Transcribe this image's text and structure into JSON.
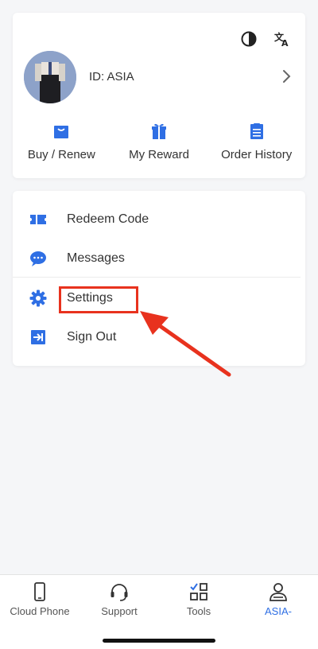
{
  "profile": {
    "user_id": "ID: ASIA",
    "top_icons": [
      "contrast-icon",
      "translate-icon"
    ],
    "quick_actions": [
      {
        "label": "Buy / Renew",
        "icon": "shopping-bag-icon"
      },
      {
        "label": "My Reward",
        "icon": "gift-icon"
      },
      {
        "label": "Order History",
        "icon": "document-icon"
      }
    ]
  },
  "menu": {
    "items": [
      {
        "label": "Redeem Code",
        "icon": "ticket-icon"
      },
      {
        "label": "Messages",
        "icon": "chat-bubble-icon"
      },
      {
        "label": "Settings",
        "icon": "gear-icon"
      },
      {
        "label": "Sign Out",
        "icon": "sign-out-icon"
      }
    ]
  },
  "bottom_nav": {
    "tabs": [
      {
        "label": "Cloud Phone",
        "icon": "phone-icon"
      },
      {
        "label": "Support",
        "icon": "headset-icon"
      },
      {
        "label": "Tools",
        "icon": "tools-grid-icon"
      },
      {
        "label": "ASIA-",
        "icon": "user-icon",
        "active": true
      }
    ]
  },
  "colors": {
    "accent": "#2f6fe4",
    "annotation": "#e8321e",
    "background": "#f5f6f8"
  }
}
